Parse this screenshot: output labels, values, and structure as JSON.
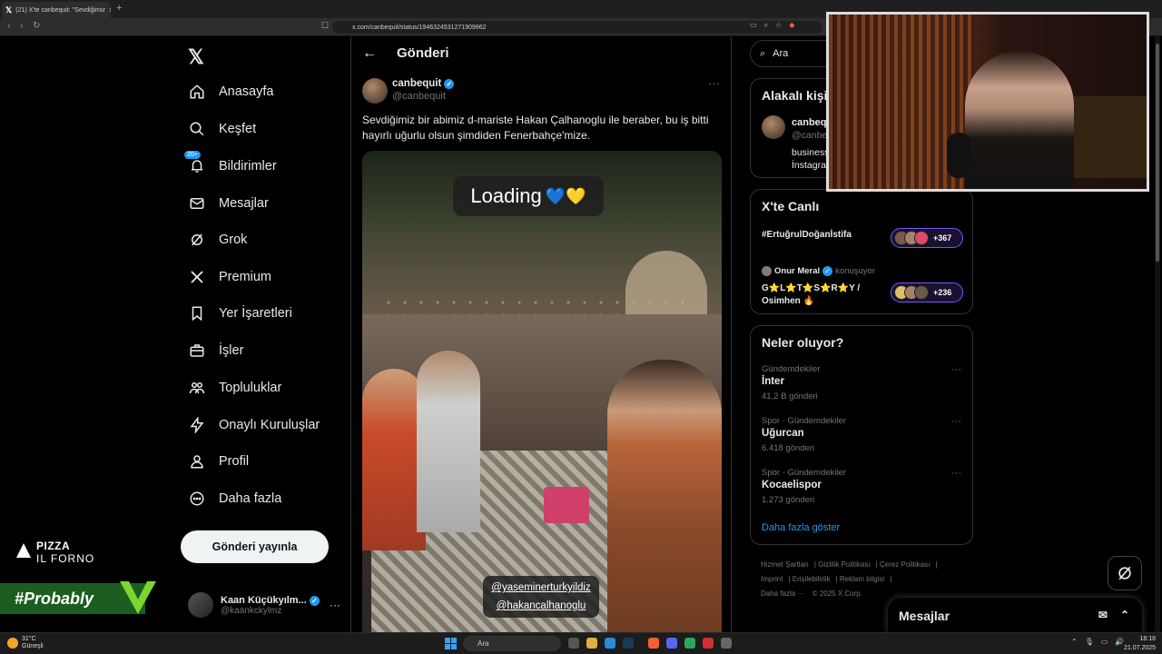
{
  "browser": {
    "tab_title": "(21) X'te canbequit: \"Sevdiğimiz",
    "url": "x.com/canbequit/status/1946324531271909862"
  },
  "sidebar": {
    "items": [
      {
        "label": "Anasayfa",
        "icon": "home-icon"
      },
      {
        "label": "Keşfet",
        "icon": "search-icon"
      },
      {
        "label": "Bildirimler",
        "icon": "bell-icon",
        "badge": "20+"
      },
      {
        "label": "Mesajlar",
        "icon": "mail-icon"
      },
      {
        "label": "Grok",
        "icon": "grok-icon"
      },
      {
        "label": "Premium",
        "icon": "x-icon"
      },
      {
        "label": "Yer İşaretleri",
        "icon": "bookmark-icon"
      },
      {
        "label": "İşler",
        "icon": "briefcase-icon"
      },
      {
        "label": "Topluluklar",
        "icon": "people-icon"
      },
      {
        "label": "Onaylı Kuruluşlar",
        "icon": "lightning-icon"
      },
      {
        "label": "Profil",
        "icon": "profile-icon"
      },
      {
        "label": "Daha fazla",
        "icon": "more-circle-icon"
      }
    ],
    "post_button": "Gönderi yayınla",
    "account": {
      "name": "Kaan Küçükyılm...",
      "handle": "@kaankckylmz"
    }
  },
  "overlays": {
    "pizza_line1": "PIZZA",
    "pizza_line2": "IL FORNO",
    "probably": "#Probably"
  },
  "main": {
    "header_title": "Gönderi",
    "tweet": {
      "name": "canbequit",
      "handle": "@canbequit",
      "text": "Sevdiğimiz bir abimiz d-mariste Hakan Çalhanoglu ile beraber, bu iş bitti hayırlı uğurlu olsun şimdiden Fenerbahçe'mize.",
      "sticker_loading": "Loading",
      "sticker_hearts": "💙💛",
      "tag1": "@yaseminerturkyildiz",
      "tag2": "@hakancalhanoglu"
    }
  },
  "right": {
    "search_placeholder": "Ara",
    "related": {
      "title": "Alakalı kişiler",
      "name": "canbequit",
      "handle": "@canbequit",
      "bio_line1": "business",
      "bio_line2": "İnstagram"
    },
    "live": {
      "title": "X'te Canlı",
      "topic1": "#ErtuğrulDoğanİstifa",
      "count1": "+367",
      "host": "Onur Meral",
      "host_status": "konuşuyor",
      "topic2_line1": "G⭐L⭐T⭐S⭐R⭐Y /",
      "topic2_line2": "Osimhen 🔥",
      "count2": "+236"
    },
    "trends": {
      "title": "Neler oluyor?",
      "items": [
        {
          "meta": "Gündemdekiler",
          "name": "İnter",
          "count": "41,2 B gönderi"
        },
        {
          "meta": "Spor · Gündemdekiler",
          "name": "Uğurcan",
          "count": "6.418 gönderi"
        },
        {
          "meta": "Spor · Gündemdekiler",
          "name": "Kocaelispor",
          "count": "1.273 gönderi"
        }
      ],
      "show_more": "Daha fazla göster"
    },
    "footer": {
      "l1": "Hizmet Şartları",
      "l2": "Gizlilik Politikası",
      "l3": "Çerez Politikası",
      "l4": "Imprint",
      "l5": "Erişilebilirlik",
      "l6": "Reklam bilgisi",
      "l7": "Daha fazla ···",
      "l8": "© 2025 X Corp."
    }
  },
  "messages_drawer": {
    "title": "Mesajlar"
  },
  "taskbar": {
    "temp": "31°C",
    "weather": "Güneşli",
    "search": "Ara",
    "time": "18:18",
    "date": "21.07.2025"
  },
  "colors": {
    "accent": "#1d9bf0",
    "background": "#000000",
    "live_border": "#7856ff"
  }
}
